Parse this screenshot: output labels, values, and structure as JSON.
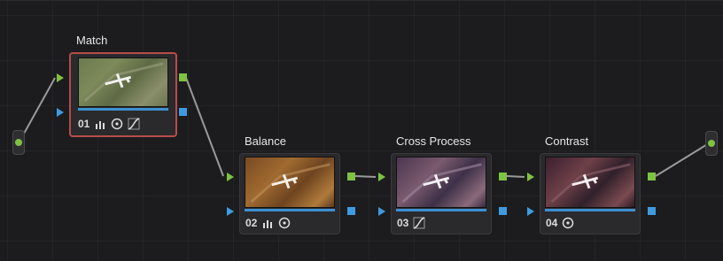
{
  "colors": {
    "background": "#1c1c1e",
    "selected_border": "#b84c4a",
    "rgb_port": "#7dc242",
    "key_port": "#3f9be0",
    "wire": "#9a9a9a"
  },
  "input_node": {
    "icon": "green-dot-icon"
  },
  "output_node": {
    "icon": "green-dot-icon"
  },
  "nodes": [
    {
      "title": "Match",
      "number": "01",
      "tools": [
        "levels-icon",
        "circle-dot-icon",
        "curves-icon"
      ],
      "selected": true,
      "tint": "match"
    },
    {
      "title": "Balance",
      "number": "02",
      "tools": [
        "levels-icon",
        "circle-dot-icon"
      ],
      "selected": false,
      "tint": "balance"
    },
    {
      "title": "Cross Process",
      "number": "03",
      "tools": [
        "curves-icon"
      ],
      "selected": false,
      "tint": "cross"
    },
    {
      "title": "Contrast",
      "number": "04",
      "tools": [
        "circle-dot-icon"
      ],
      "selected": false,
      "tint": "contrast"
    }
  ]
}
